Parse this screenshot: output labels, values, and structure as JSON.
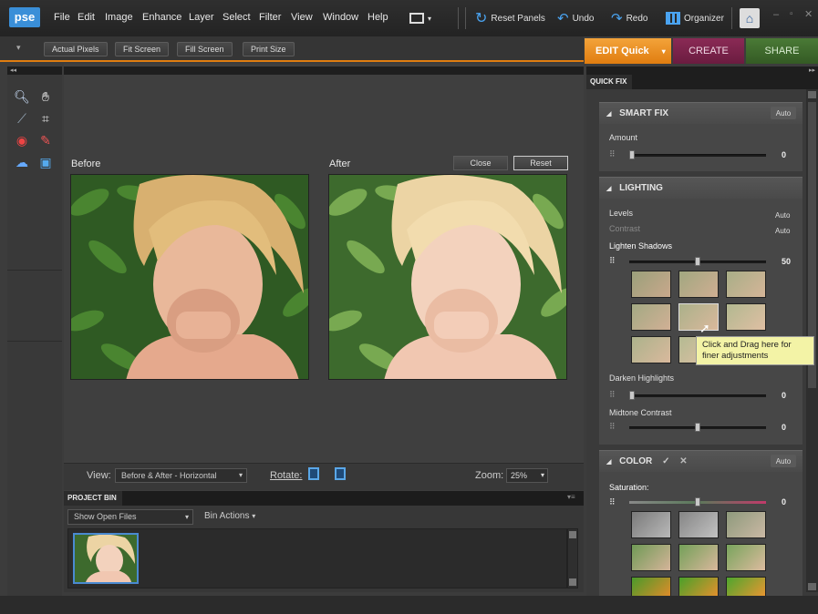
{
  "app": {
    "logo": "pse"
  },
  "menu": [
    "File",
    "Edit",
    "Image",
    "Enhance",
    "Layer",
    "Select",
    "Filter",
    "View",
    "Window",
    "Help"
  ],
  "toolbar_buttons": {
    "reset_panels": "Reset Panels",
    "undo": "Undo",
    "redo": "Redo",
    "organizer": "Organizer"
  },
  "options": [
    "Actual Pixels",
    "Fit Screen",
    "Fill Screen",
    "Print Size"
  ],
  "modes": {
    "edit": "EDIT Quick",
    "create": "CREATE",
    "share": "SHARE"
  },
  "canvas": {
    "before_label": "Before",
    "after_label": "After",
    "close_label": "Close",
    "reset_label": "Reset"
  },
  "viewbar": {
    "view_label": "View:",
    "view_value": "Before & After - Horizontal",
    "rotate_label": "Rotate:",
    "zoom_label": "Zoom:",
    "zoom_value": "25%"
  },
  "bin": {
    "tab_label": "PROJECT BIN",
    "show_value": "Show Open Files",
    "actions_label": "Bin Actions"
  },
  "panel": {
    "tab_label": "QUICK FIX",
    "smart_fix": {
      "title": "SMART FIX",
      "auto": "Auto",
      "amount_label": "Amount",
      "amount_value": "0",
      "amount_level": 0
    },
    "lighting": {
      "title": "LIGHTING",
      "levels_label": "Levels",
      "levels_auto": "Auto",
      "contrast_label": "Contrast",
      "contrast_auto": "Auto",
      "lighten_label": "Lighten Shadows",
      "lighten_value": "50",
      "lighten_level": 0.5,
      "tooltip": "Click and Drag here for finer adjustments",
      "darken_label": "Darken Highlights",
      "darken_value": "0",
      "midtone_label": "Midtone Contrast",
      "midtone_value": "0"
    },
    "color": {
      "title": "COLOR",
      "auto": "Auto",
      "saturation_label": "Saturation:",
      "saturation_value": "0"
    }
  }
}
